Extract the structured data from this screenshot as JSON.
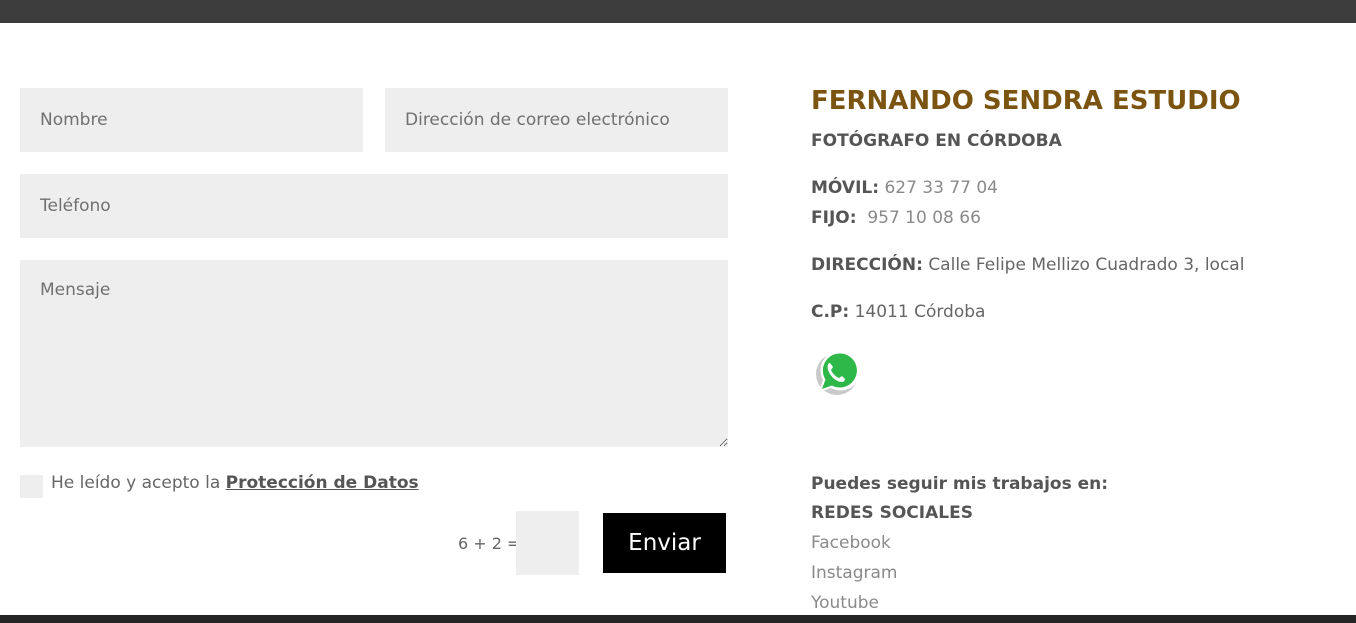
{
  "form": {
    "name_placeholder": "Nombre",
    "email_placeholder": "Dirección de correo electrónico",
    "phone_placeholder": "Teléfono",
    "message_placeholder": "Mensaje",
    "consent_text": "He leído y acepto la ",
    "consent_link": "Protección de Datos",
    "captcha_question": "6 + 2 =",
    "submit_label": "Enviar"
  },
  "contact": {
    "studio_name": "FERNANDO SENDRA ESTUDIO",
    "subtitle": "FOTÓGRAFO EN CÓRDOBA",
    "mobile_label": "MÓVIL:",
    "mobile_value": "627 33 77 04",
    "landline_label": "FIJO:",
    "landline_value": "957 10 08 66",
    "address_label": "DIRECCIÓN:",
    "address_value": "Calle Felipe Mellizo Cuadrado 3, local",
    "postal_label": "C.P:",
    "postal_value": "14011 Córdoba",
    "whatsapp_icon": "whatsapp-icon",
    "follow_text": "Puedes seguir mis trabajos en:",
    "social_heading": "REDES SOCIALES",
    "social_links": [
      "Facebook",
      "Instagram",
      "Youtube"
    ]
  },
  "colors": {
    "title_brown": "#7a5410",
    "field_bg": "#eeeeee",
    "button_bg": "#000000",
    "whatsapp_green": "#2fb84a"
  }
}
